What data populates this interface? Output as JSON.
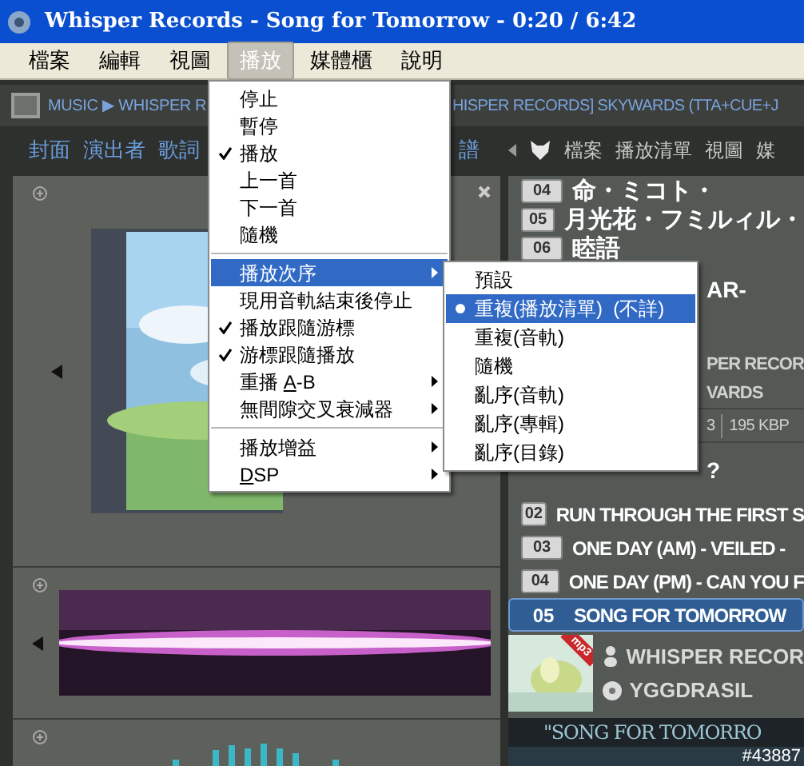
{
  "window": {
    "title": "Whisper Records - Song for Tomorrow - 0:20 / 6:42"
  },
  "menubar": [
    {
      "label": "檔案",
      "selected": false
    },
    {
      "label": "編輯",
      "selected": false
    },
    {
      "label": "視圖",
      "selected": false
    },
    {
      "label": "播放",
      "selected": true
    },
    {
      "label": "媒體櫃",
      "selected": false
    },
    {
      "label": "說明",
      "selected": false
    }
  ],
  "breadcrumb": {
    "left": "MUSIC ▶ WHISPER R",
    "right": "HISPER RECORDS] SKYWARDS (TTA+CUE+J"
  },
  "left_tabs": [
    {
      "label": "封面"
    },
    {
      "label": "演出者"
    },
    {
      "label": "歌詞"
    }
  ],
  "left_tabs_tail": "譜",
  "right_tabs": [
    {
      "label": "檔案"
    },
    {
      "label": "播放清單"
    },
    {
      "label": "視圖"
    },
    {
      "label": "媒"
    }
  ],
  "play_menu": [
    {
      "kind": "item",
      "label": "停止",
      "checked": false,
      "submenu": false,
      "selected": false
    },
    {
      "kind": "item",
      "label": "暫停",
      "checked": false,
      "submenu": false,
      "selected": false
    },
    {
      "kind": "item",
      "label": "播放",
      "checked": true,
      "submenu": false,
      "selected": false
    },
    {
      "kind": "item",
      "label": "上一首",
      "checked": false,
      "submenu": false,
      "selected": false
    },
    {
      "kind": "item",
      "label": "下一首",
      "checked": false,
      "submenu": false,
      "selected": false
    },
    {
      "kind": "item",
      "label": "隨機",
      "checked": false,
      "submenu": false,
      "selected": false
    },
    {
      "kind": "separator"
    },
    {
      "kind": "item",
      "label": "播放次序",
      "checked": false,
      "submenu": true,
      "selected": true
    },
    {
      "kind": "item",
      "label": "現用音軌結束後停止",
      "checked": false,
      "submenu": false,
      "selected": false
    },
    {
      "kind": "item",
      "label": "播放跟隨游標",
      "checked": true,
      "submenu": false,
      "selected": false
    },
    {
      "kind": "item",
      "label": "游標跟隨播放",
      "checked": true,
      "submenu": false,
      "selected": false
    },
    {
      "kind": "item",
      "label": "重播 ",
      "accel": "A",
      "label_after": "-B",
      "checked": false,
      "submenu": true,
      "selected": false
    },
    {
      "kind": "item",
      "label": "無間隙交叉衰減器",
      "checked": false,
      "submenu": true,
      "selected": false
    },
    {
      "kind": "separator"
    },
    {
      "kind": "item",
      "label": "播放增益",
      "checked": false,
      "submenu": true,
      "selected": false
    },
    {
      "kind": "item",
      "accel": "D",
      "label_after": "SP",
      "checked": false,
      "submenu": true,
      "selected": false
    }
  ],
  "order_submenu": [
    {
      "label": "預設",
      "selected": false
    },
    {
      "label": "重複(播放清單)  (不詳)",
      "selected": true
    },
    {
      "label": "重複(音軌)",
      "selected": false
    },
    {
      "label": "隨機",
      "selected": false
    },
    {
      "label": "亂序(音軌)",
      "selected": false
    },
    {
      "label": "亂序(專輯)",
      "selected": false
    },
    {
      "label": "亂序(目錄)",
      "selected": false
    }
  ],
  "playlist_top": [
    {
      "kind": "track",
      "number": "04",
      "title": "命・ミコト・"
    },
    {
      "kind": "track",
      "number": "05",
      "title": "月光花・フミルィル・"
    },
    {
      "kind": "track",
      "number": "06",
      "title": "睦語"
    },
    {
      "kind": "fragment",
      "text": "AR-"
    },
    {
      "kind": "gap"
    },
    {
      "kind": "header",
      "text": "PER RECOR"
    },
    {
      "kind": "header",
      "text": "VARDS"
    },
    {
      "kind": "info",
      "text": "3",
      "extra": "195 KBP"
    },
    {
      "kind": "fragment",
      "text": "?"
    }
  ],
  "playlist": [
    {
      "number": "02",
      "title": "RUN THROUGH THE FIRST S",
      "selected": false
    },
    {
      "number": "03",
      "title": "ONE DAY (AM) - VEILED -",
      "selected": false
    },
    {
      "number": "04",
      "title": "ONE DAY (PM) - CAN YOU F",
      "selected": false
    },
    {
      "number": "05",
      "title": "SONG FOR TOMORROW",
      "selected": true
    }
  ],
  "now_playing": {
    "badge": "mp3",
    "artist": "WHISPER RECOR",
    "album": "YGGDRASIL",
    "banner": "\"SONG FOR TOMORRO",
    "counter": "#43887"
  }
}
